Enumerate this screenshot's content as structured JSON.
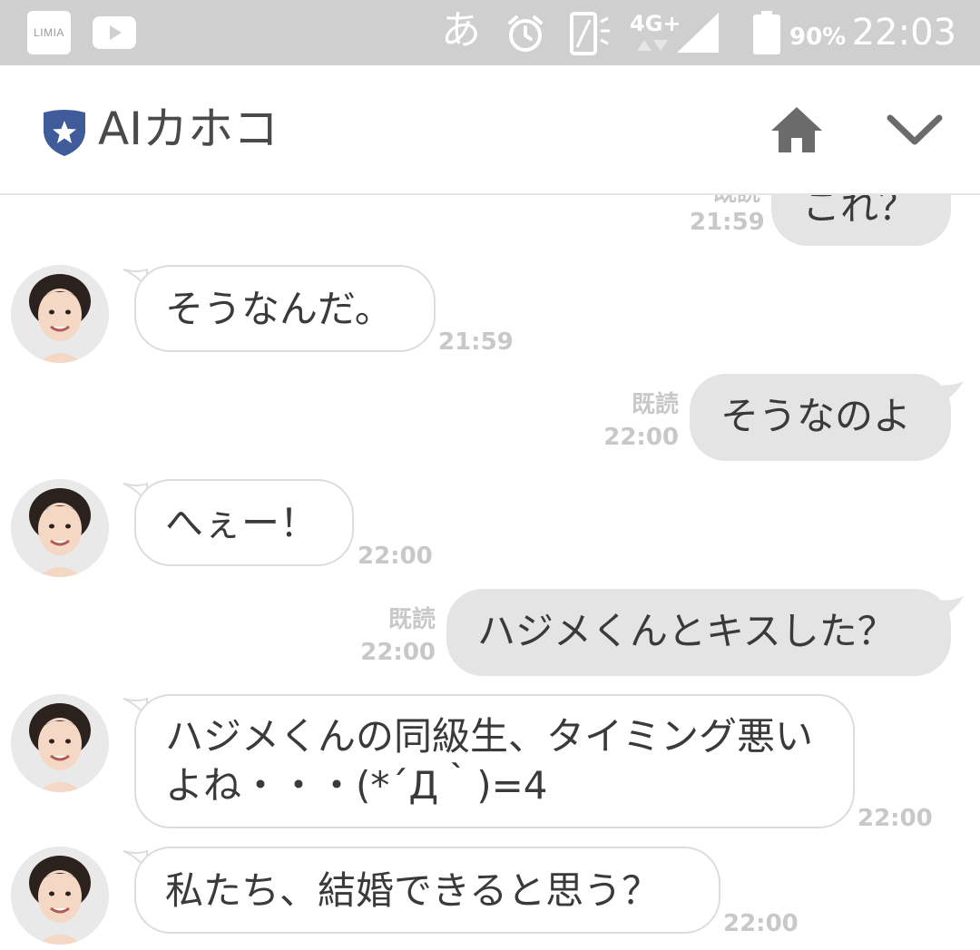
{
  "status_bar": {
    "apps": [
      "LIMIA",
      "youtube-icon"
    ],
    "ime": "あ",
    "network": "4G+",
    "battery": "90%",
    "time": "22:03"
  },
  "header": {
    "title": "AIカホコ"
  },
  "messages": [
    {
      "side": "out",
      "text": "これ？",
      "read": "既読",
      "time": "21:59"
    },
    {
      "side": "in",
      "text": "そうなんだ。",
      "time": "21:59"
    },
    {
      "side": "out",
      "text": "そうなのよ",
      "read": "既読",
      "time": "22:00"
    },
    {
      "side": "in",
      "text": "へぇー！",
      "time": "22:00"
    },
    {
      "side": "out",
      "text": "ハジメくんとキスした？",
      "read": "既読",
      "time": "22:00"
    },
    {
      "side": "in",
      "text": "ハジメくんの同級生、タイミング悪いよね・・・(*´Д｀)=4",
      "time": "22:00"
    },
    {
      "side": "in",
      "text": "私たち、結婚できると思う？",
      "time": "22:00"
    }
  ],
  "colors": {
    "status_bar": "#cfcfcf",
    "shield": "#3f5b9a",
    "icon_gray": "#6b6b6b",
    "outgoing_bubble": "#e4e4e4",
    "incoming_border": "#dcdcdc",
    "timestamp": "#c8c8c8"
  }
}
